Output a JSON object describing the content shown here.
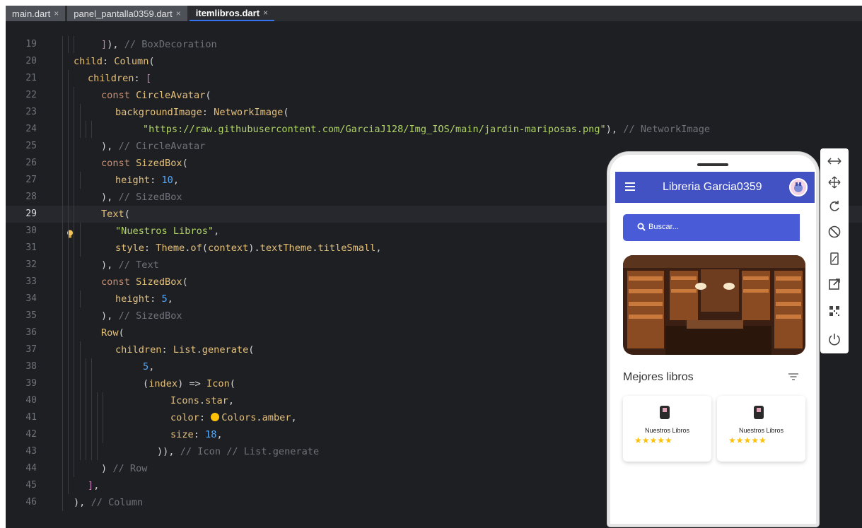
{
  "tabs": [
    {
      "label": "main.dart",
      "close": "×",
      "active": false
    },
    {
      "label": "panel_pantalla0359.dart",
      "close": "×",
      "active": false
    },
    {
      "label": "itemlibros.dart",
      "close": "×",
      "active": true
    }
  ],
  "editor": {
    "current_line": "29",
    "lines": [
      {
        "n": "19",
        "parts": [
          [
            "pk",
            "]"
          ],
          [
            "pr",
            ")"
          ],
          [
            "pr",
            ", "
          ],
          [
            "cm",
            "// BoxDecoration"
          ]
        ]
      },
      {
        "n": "20",
        "parts": [
          [
            "y",
            "child"
          ],
          [
            "pr",
            ": "
          ],
          [
            "y",
            "Column"
          ],
          [
            "pr",
            "("
          ]
        ]
      },
      {
        "n": "21",
        "parts": [
          [
            "y",
            "children"
          ],
          [
            "pr",
            ": "
          ],
          [
            "pk",
            "["
          ]
        ]
      },
      {
        "n": "22",
        "parts": [
          [
            "kw",
            "const "
          ],
          [
            "y",
            "CircleAvatar"
          ],
          [
            "pr",
            "("
          ]
        ]
      },
      {
        "n": "23",
        "parts": [
          [
            "y",
            "backgroundImage"
          ],
          [
            "pr",
            ": "
          ],
          [
            "y",
            "NetworkImage"
          ],
          [
            "pr",
            "("
          ]
        ]
      },
      {
        "n": "24",
        "parts": [
          [
            "st",
            "\"https://raw.githubusercontent.com/GarciaJ128/Img_IOS/main/jardin-mariposas.png\""
          ],
          [
            "pr",
            "), "
          ],
          [
            "cm",
            "// NetworkImage"
          ]
        ]
      },
      {
        "n": "25",
        "parts": [
          [
            "pr",
            "), "
          ],
          [
            "cm",
            "// CircleAvatar"
          ]
        ]
      },
      {
        "n": "26",
        "parts": [
          [
            "kw",
            "const "
          ],
          [
            "y",
            "SizedBox"
          ],
          [
            "pr",
            "("
          ]
        ]
      },
      {
        "n": "27",
        "parts": [
          [
            "y",
            "height"
          ],
          [
            "pr",
            ": "
          ],
          [
            "bl",
            "10"
          ],
          [
            "pr",
            ","
          ]
        ]
      },
      {
        "n": "28",
        "parts": [
          [
            "pr",
            "), "
          ],
          [
            "cm",
            "// SizedBox"
          ]
        ]
      },
      {
        "n": "29",
        "parts": [
          [
            "y",
            "Text"
          ],
          [
            "pr",
            "("
          ]
        ]
      },
      {
        "n": "30",
        "parts": [
          [
            "st",
            "\"Nuestros Libros\""
          ],
          [
            "pr",
            ","
          ]
        ]
      },
      {
        "n": "31",
        "parts": [
          [
            "y",
            "style"
          ],
          [
            "pr",
            ": "
          ],
          [
            "y",
            "Theme"
          ],
          [
            "pr",
            "."
          ],
          [
            "y",
            "of"
          ],
          [
            "pr",
            "("
          ],
          [
            "y",
            "context"
          ],
          [
            "pr",
            ")."
          ],
          [
            "y",
            "textTheme"
          ],
          [
            "pr",
            "."
          ],
          [
            "y",
            "titleSmall"
          ],
          [
            "pr",
            ","
          ]
        ]
      },
      {
        "n": "32",
        "parts": [
          [
            "pr",
            "), "
          ],
          [
            "cm",
            "// Text"
          ]
        ]
      },
      {
        "n": "33",
        "parts": [
          [
            "kw",
            "const "
          ],
          [
            "y",
            "SizedBox"
          ],
          [
            "pr",
            "("
          ]
        ]
      },
      {
        "n": "34",
        "parts": [
          [
            "y",
            "height"
          ],
          [
            "pr",
            ": "
          ],
          [
            "bl",
            "5"
          ],
          [
            "pr",
            ","
          ]
        ]
      },
      {
        "n": "35",
        "parts": [
          [
            "pr",
            "), "
          ],
          [
            "cm",
            "// SizedBox"
          ]
        ]
      },
      {
        "n": "36",
        "parts": [
          [
            "y",
            "Row"
          ],
          [
            "pr",
            "("
          ]
        ]
      },
      {
        "n": "37",
        "parts": [
          [
            "y",
            "children"
          ],
          [
            "pr",
            ": "
          ],
          [
            "y",
            "List"
          ],
          [
            "pr",
            "."
          ],
          [
            "y",
            "generate"
          ],
          [
            "pr",
            "("
          ]
        ]
      },
      {
        "n": "38",
        "parts": [
          [
            "bl",
            "5"
          ],
          [
            "pr",
            ","
          ]
        ]
      },
      {
        "n": "39",
        "parts": [
          [
            "pr",
            "("
          ],
          [
            "y",
            "index"
          ],
          [
            "pr",
            ") => "
          ],
          [
            "y",
            "Icon"
          ],
          [
            "pr",
            "("
          ]
        ]
      },
      {
        "n": "40",
        "parts": [
          [
            "y",
            "Icons"
          ],
          [
            "pr",
            "."
          ],
          [
            "y",
            "star"
          ],
          [
            "pr",
            ","
          ]
        ]
      },
      {
        "n": "41",
        "parts": [
          [
            "y",
            "color"
          ],
          [
            "pr",
            ": "
          ],
          [
            "swatch",
            ""
          ],
          [
            "y",
            "Colors"
          ],
          [
            "pr",
            "."
          ],
          [
            "y",
            "amber"
          ],
          [
            "pr",
            ","
          ]
        ]
      },
      {
        "n": "42",
        "parts": [
          [
            "y",
            "size"
          ],
          [
            "pr",
            ": "
          ],
          [
            "bl",
            "18"
          ],
          [
            "pr",
            ","
          ]
        ]
      },
      {
        "n": "43",
        "parts": [
          [
            "pr",
            ")), "
          ],
          [
            "cm",
            "// Icon // List.generate"
          ]
        ]
      },
      {
        "n": "44",
        "parts": [
          [
            "pr",
            ") "
          ],
          [
            "cm",
            "// Row"
          ]
        ]
      },
      {
        "n": "45",
        "parts": [
          [
            "pk",
            "]"
          ],
          [
            "pr",
            ","
          ]
        ]
      },
      {
        "n": "46",
        "parts": [
          [
            "pr",
            "), "
          ],
          [
            "cm",
            "// Column"
          ]
        ]
      }
    ]
  },
  "phone": {
    "app_title": "Libreria Garcia0359",
    "search_placeholder": "Buscar...",
    "section_title": "Mejores libros",
    "cards": [
      {
        "title": "Nuestros Libros",
        "stars": "★★★★★"
      },
      {
        "title": "Nuestros Libros",
        "stars": "★★★★★"
      }
    ]
  },
  "toolbar_icons": [
    "resize-arrows-icon",
    "move-icon",
    "rotate-icon",
    "no-rotate-icon",
    "device-frame-icon",
    "open-external-icon",
    "qr-code-icon",
    "power-icon"
  ],
  "colors": {
    "editor_bg": "#1e1f22",
    "appbar": "#4252c2",
    "search": "#4a5bd8",
    "amber": "#ffc107"
  }
}
